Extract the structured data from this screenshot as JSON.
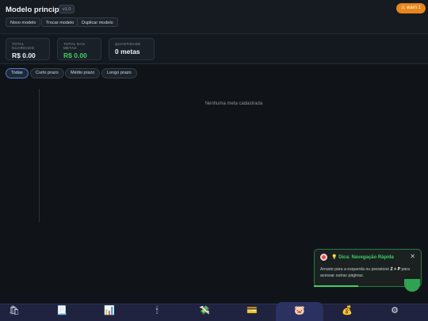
{
  "header": {
    "title": "Modelo principal",
    "version": "v1.0",
    "warn_label": "warn",
    "warn_count": "1",
    "buttons": [
      "Novo modelo",
      "Trocar modelo",
      "Duplicar modelo"
    ]
  },
  "stats": [
    {
      "label": "TOTAL GUARDADO",
      "value": "R$ 0.00"
    },
    {
      "label": "TOTAL DAS METAS",
      "value": "R$ 0.00"
    },
    {
      "label": "QUANTIDADE",
      "value": "0 metas"
    }
  ],
  "filters": [
    "Todas",
    "Curto prazo",
    "Médio prazo",
    "Longo prazo"
  ],
  "active_filter": "Todas",
  "empty_message": "Nenhuma meta cadastrada",
  "toast": {
    "title": "💡 Dica: Navegação Rápida",
    "body_prefix": "Arraste para a esquerda ou pressione ",
    "shortcut": "Z + P",
    "body_suffix": " para acessar outras páginas.",
    "close": "✕"
  },
  "nav": [
    {
      "icon": "shopping-bags-icon",
      "glyph": "🛍"
    },
    {
      "icon": "receipt-icon",
      "glyph": "📃"
    },
    {
      "icon": "bar-chart-icon",
      "glyph": "📊"
    },
    {
      "icon": "candle-icon",
      "glyph": "🕯"
    },
    {
      "icon": "money-wings-icon",
      "glyph": "💸"
    },
    {
      "icon": "credit-card-icon",
      "glyph": "💳"
    },
    {
      "icon": "piggy-bank-icon",
      "glyph": "🐷"
    },
    {
      "icon": "money-bag-icon",
      "glyph": "💰"
    },
    {
      "icon": "gear-icon",
      "glyph": "⚙"
    }
  ],
  "colors": {
    "accent_green": "#3fcf63",
    "warn": "#e8861a",
    "active_filter": "#4a7cc7"
  }
}
